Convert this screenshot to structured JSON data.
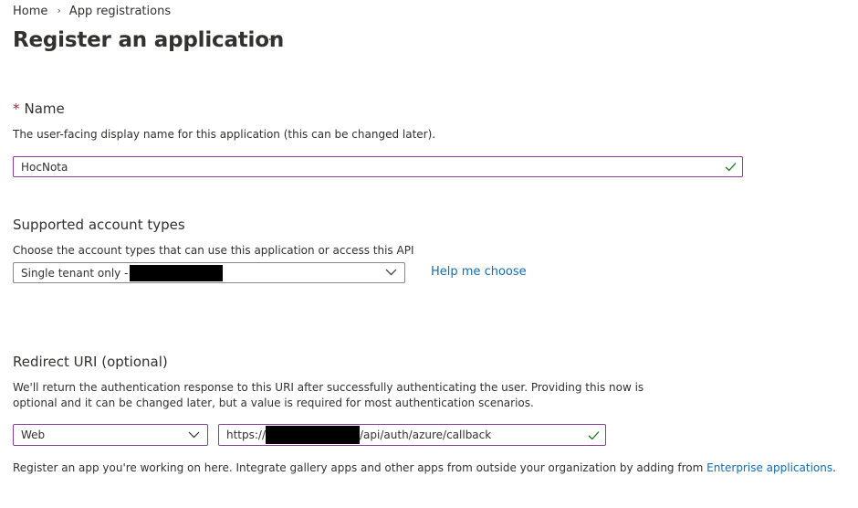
{
  "breadcrumb": {
    "home": "Home",
    "separator": "›",
    "current": "App registrations"
  },
  "page": {
    "title": "Register an application",
    "more_label": "···"
  },
  "name_section": {
    "required_marker": "*",
    "label": "Name",
    "description": "The user-facing display name for this application (this can be changed later).",
    "value": "HocNota"
  },
  "account_section": {
    "label": "Supported account types",
    "description": "Choose the account types that can use this application or access this API",
    "selected_prefix": "Single tenant only -",
    "help_link": "Help me choose"
  },
  "redirect_section": {
    "label": "Redirect URI (optional)",
    "description_line1": "We'll return the authentication response to this URI after successfully authenticating the user. Providing this now is",
    "description_line2": "optional and it can be changed later, but a value is required for most authentication scenarios.",
    "platform_value": "Web",
    "uri_prefix": "https://",
    "uri_suffix": "/api/auth/azure/callback"
  },
  "footer": {
    "text": "Register an app you're working on here. Integrate gallery apps and other apps from outside your organization by adding from ",
    "link": "Enterprise applications",
    "trailing": "."
  },
  "colors": {
    "focus_border": "#8a3d9c",
    "link": "#0f6cbd",
    "check": "#107c10",
    "required": "#a4262c"
  },
  "icons": {
    "check": "checkmark-icon",
    "chevron": "chevron-down-icon"
  }
}
